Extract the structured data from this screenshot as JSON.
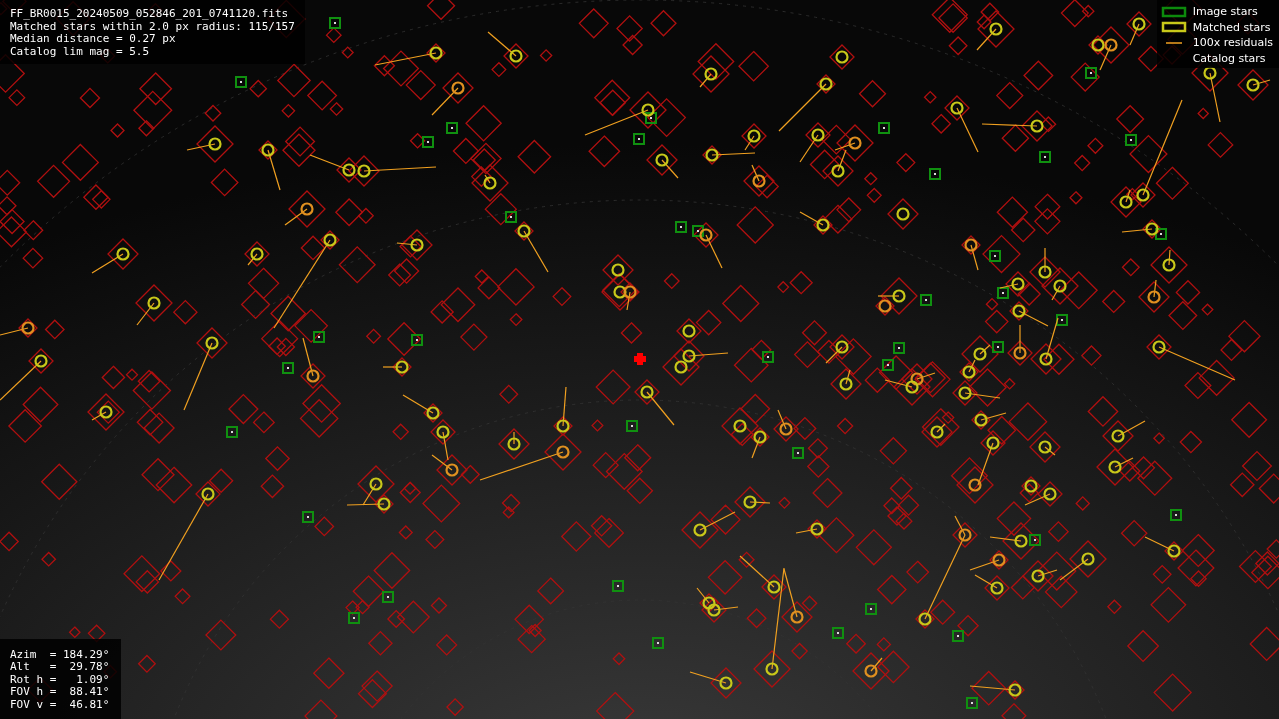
{
  "image_info": [
    "FF_BR0015_20240509_052846_201_0741120.fits",
    "Matched stars within 2.0 px radius: 115/157",
    "Median distance = 0.27 px",
    "Catalog lim mag = 5.5"
  ],
  "legend": [
    {
      "label": "Image stars",
      "kind": "image"
    },
    {
      "label": "Matched stars",
      "kind": "matched"
    },
    {
      "label": "100x residuals",
      "kind": "residual"
    },
    {
      "label": "Catalog stars",
      "kind": "catalog"
    }
  ],
  "pointing": [
    "Azim  = 184.29°",
    "Alt   =  29.78°",
    "Rot h =   1.09°",
    "FOV h =  88.41°",
    "FOV v =  46.81°"
  ]
}
